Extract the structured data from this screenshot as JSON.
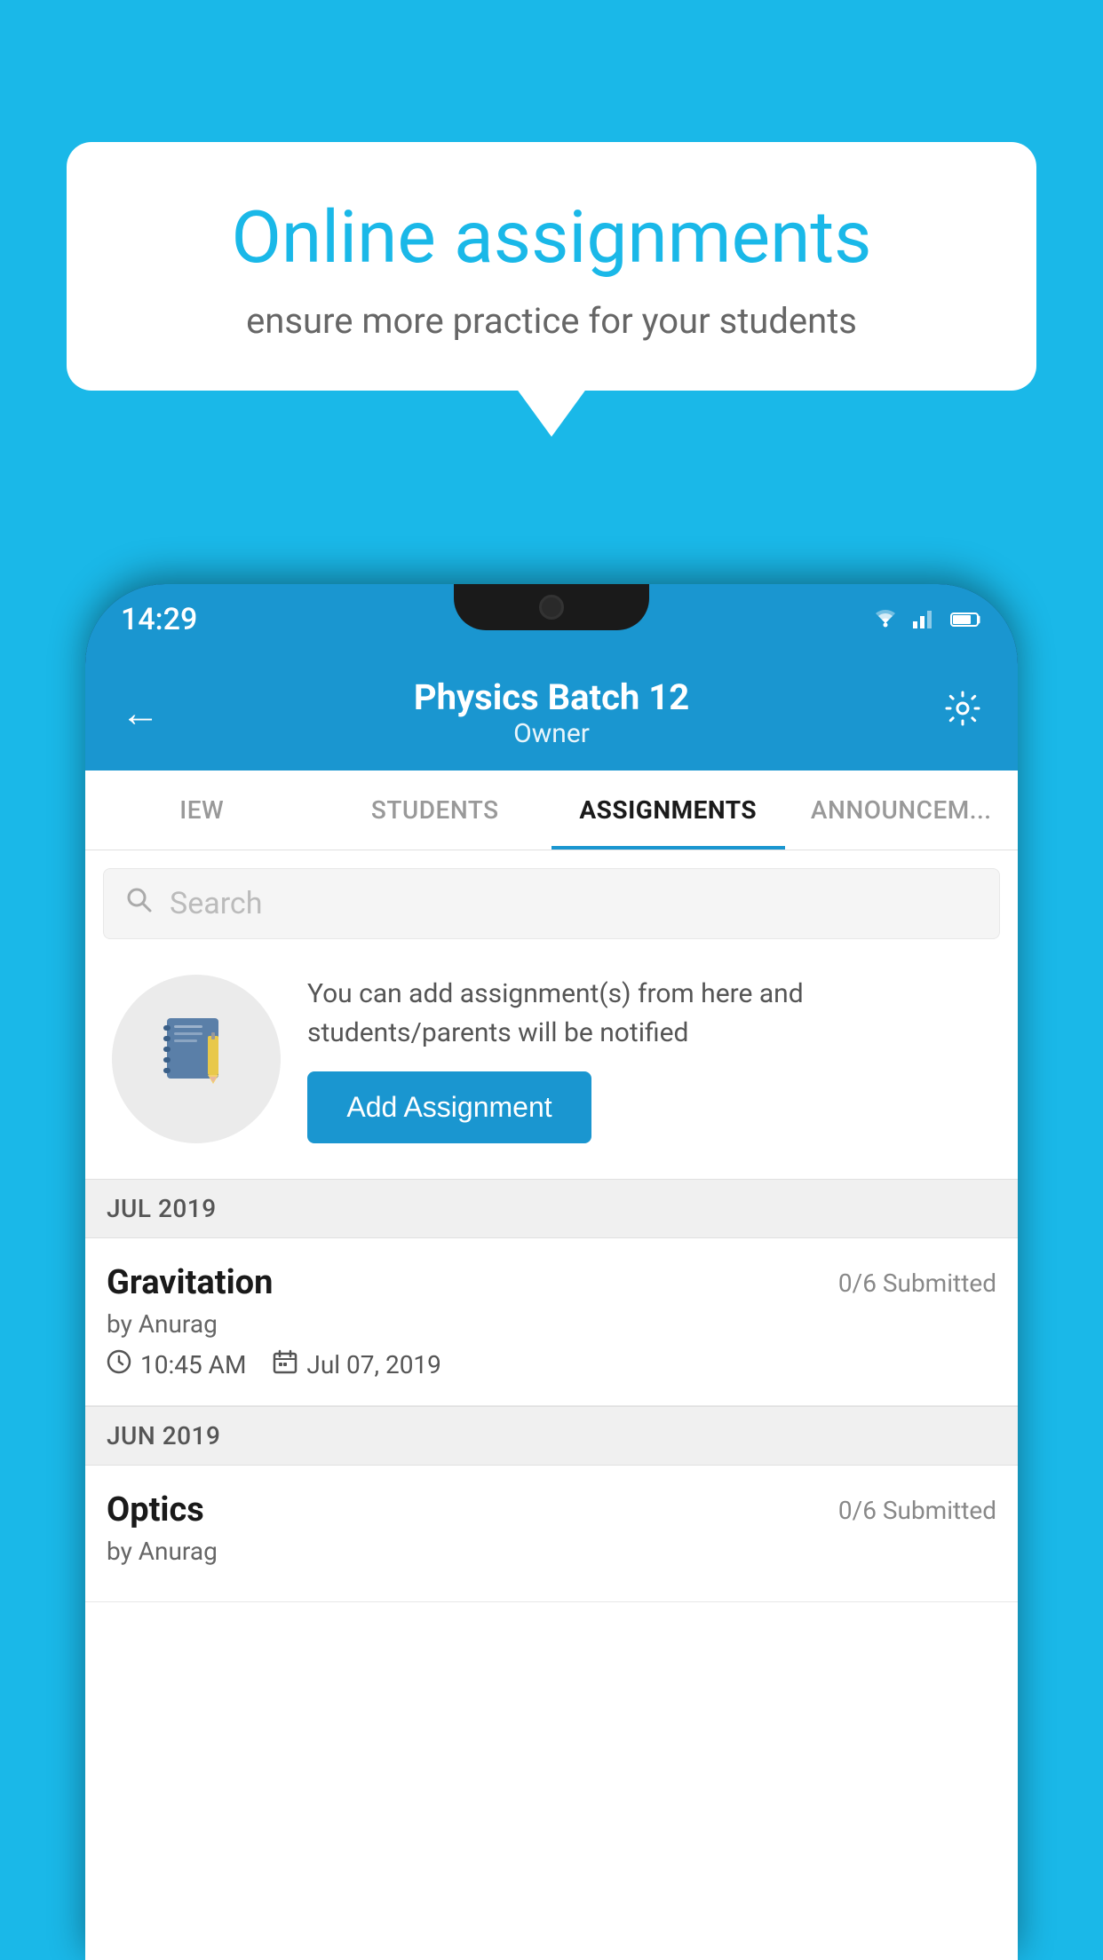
{
  "background_color": "#1ab8e8",
  "speech_bubble": {
    "title": "Online assignments",
    "subtitle": "ensure more practice for your students"
  },
  "status_bar": {
    "time": "14:29"
  },
  "header": {
    "title": "Physics Batch 12",
    "subtitle": "Owner"
  },
  "tabs": [
    {
      "id": "view",
      "label": "IEW",
      "active": false
    },
    {
      "id": "students",
      "label": "STUDENTS",
      "active": false
    },
    {
      "id": "assignments",
      "label": "ASSIGNMENTS",
      "active": true
    },
    {
      "id": "announcements",
      "label": "ANNOUNCEM...",
      "active": false
    }
  ],
  "search": {
    "placeholder": "Search"
  },
  "info_card": {
    "description": "You can add assignment(s) from here and students/parents will be notified",
    "button_label": "Add Assignment"
  },
  "sections": [
    {
      "label": "JUL 2019",
      "assignments": [
        {
          "name": "Gravitation",
          "submitted": "0/6 Submitted",
          "author": "by Anurag",
          "time": "10:45 AM",
          "date": "Jul 07, 2019"
        }
      ]
    },
    {
      "label": "JUN 2019",
      "assignments": [
        {
          "name": "Optics",
          "submitted": "0/6 Submitted",
          "author": "by Anurag",
          "time": "",
          "date": ""
        }
      ]
    }
  ]
}
